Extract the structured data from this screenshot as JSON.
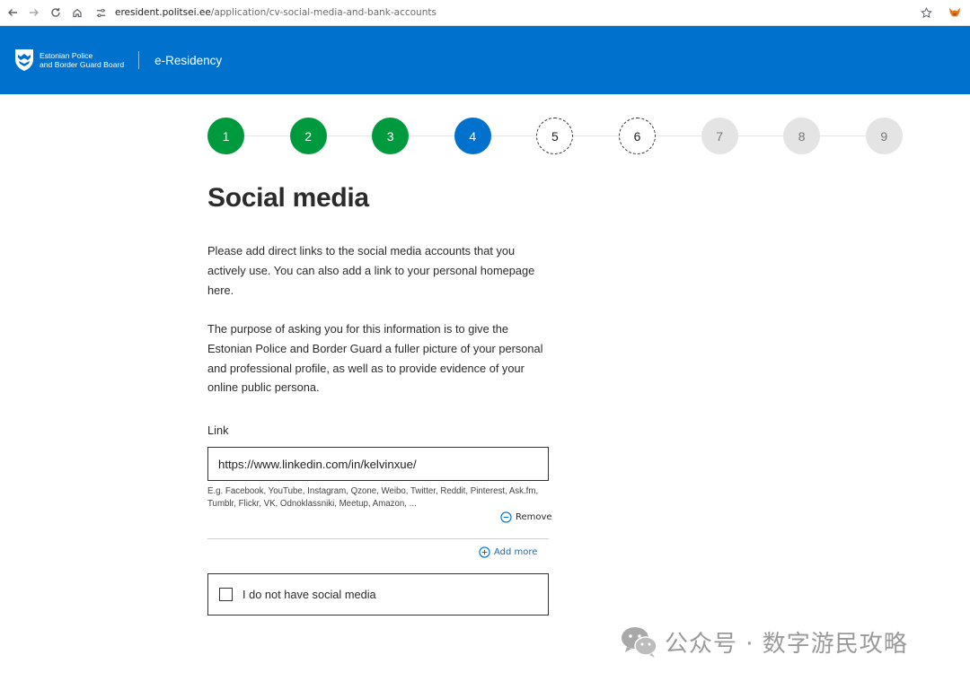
{
  "browser": {
    "url_host": "eresident.politsei.ee",
    "url_path": "/application/cv-social-media-and-bank-accounts",
    "back_icon": "arrow-left-icon",
    "forward_icon": "arrow-right-icon",
    "reload_icon": "reload-icon",
    "home_icon": "home-icon",
    "bookmark_icon": "star-icon"
  },
  "header": {
    "org_line1": "Estonian Police",
    "org_line2": "and Border Guard Board",
    "app_name": "e-Residency",
    "brand_color": "#0072ce"
  },
  "stepper": {
    "steps": [
      {
        "label": "1",
        "state": "done"
      },
      {
        "label": "2",
        "state": "done"
      },
      {
        "label": "3",
        "state": "done"
      },
      {
        "label": "4",
        "state": "active"
      },
      {
        "label": "5",
        "state": "pending-dashed"
      },
      {
        "label": "6",
        "state": "pending-dashed"
      },
      {
        "label": "7",
        "state": "pending"
      },
      {
        "label": "8",
        "state": "pending"
      },
      {
        "label": "9",
        "state": "pending"
      }
    ],
    "done_color": "#009a3e",
    "active_color": "#0072ce"
  },
  "main": {
    "title": "Social media",
    "paragraph1": "Please add direct links to the social media accounts that you actively use. You can also add a link to your personal homepage here.",
    "paragraph2": "The purpose of asking you for this information is to give the Estonian Police and Border Guard a fuller picture of your personal and professional profile, as well as to provide evidence of your online public persona.",
    "link_label": "Link",
    "link_value": "https://www.linkedin.com/in/kelvinxue/",
    "hint": "E.g. Facebook, YouTube, Instagram, Qzone, Weibo, Twitter, Reddit, Pinterest, Ask.fm, Tumblr, Flickr, VK, Odnoklassniki, Meetup, Amazon, ...",
    "remove_label": "Remove",
    "add_more_label": "Add more",
    "no_social_label": "I do not have social media"
  },
  "watermark": {
    "text": "公众号 · 数字游民攻略"
  }
}
